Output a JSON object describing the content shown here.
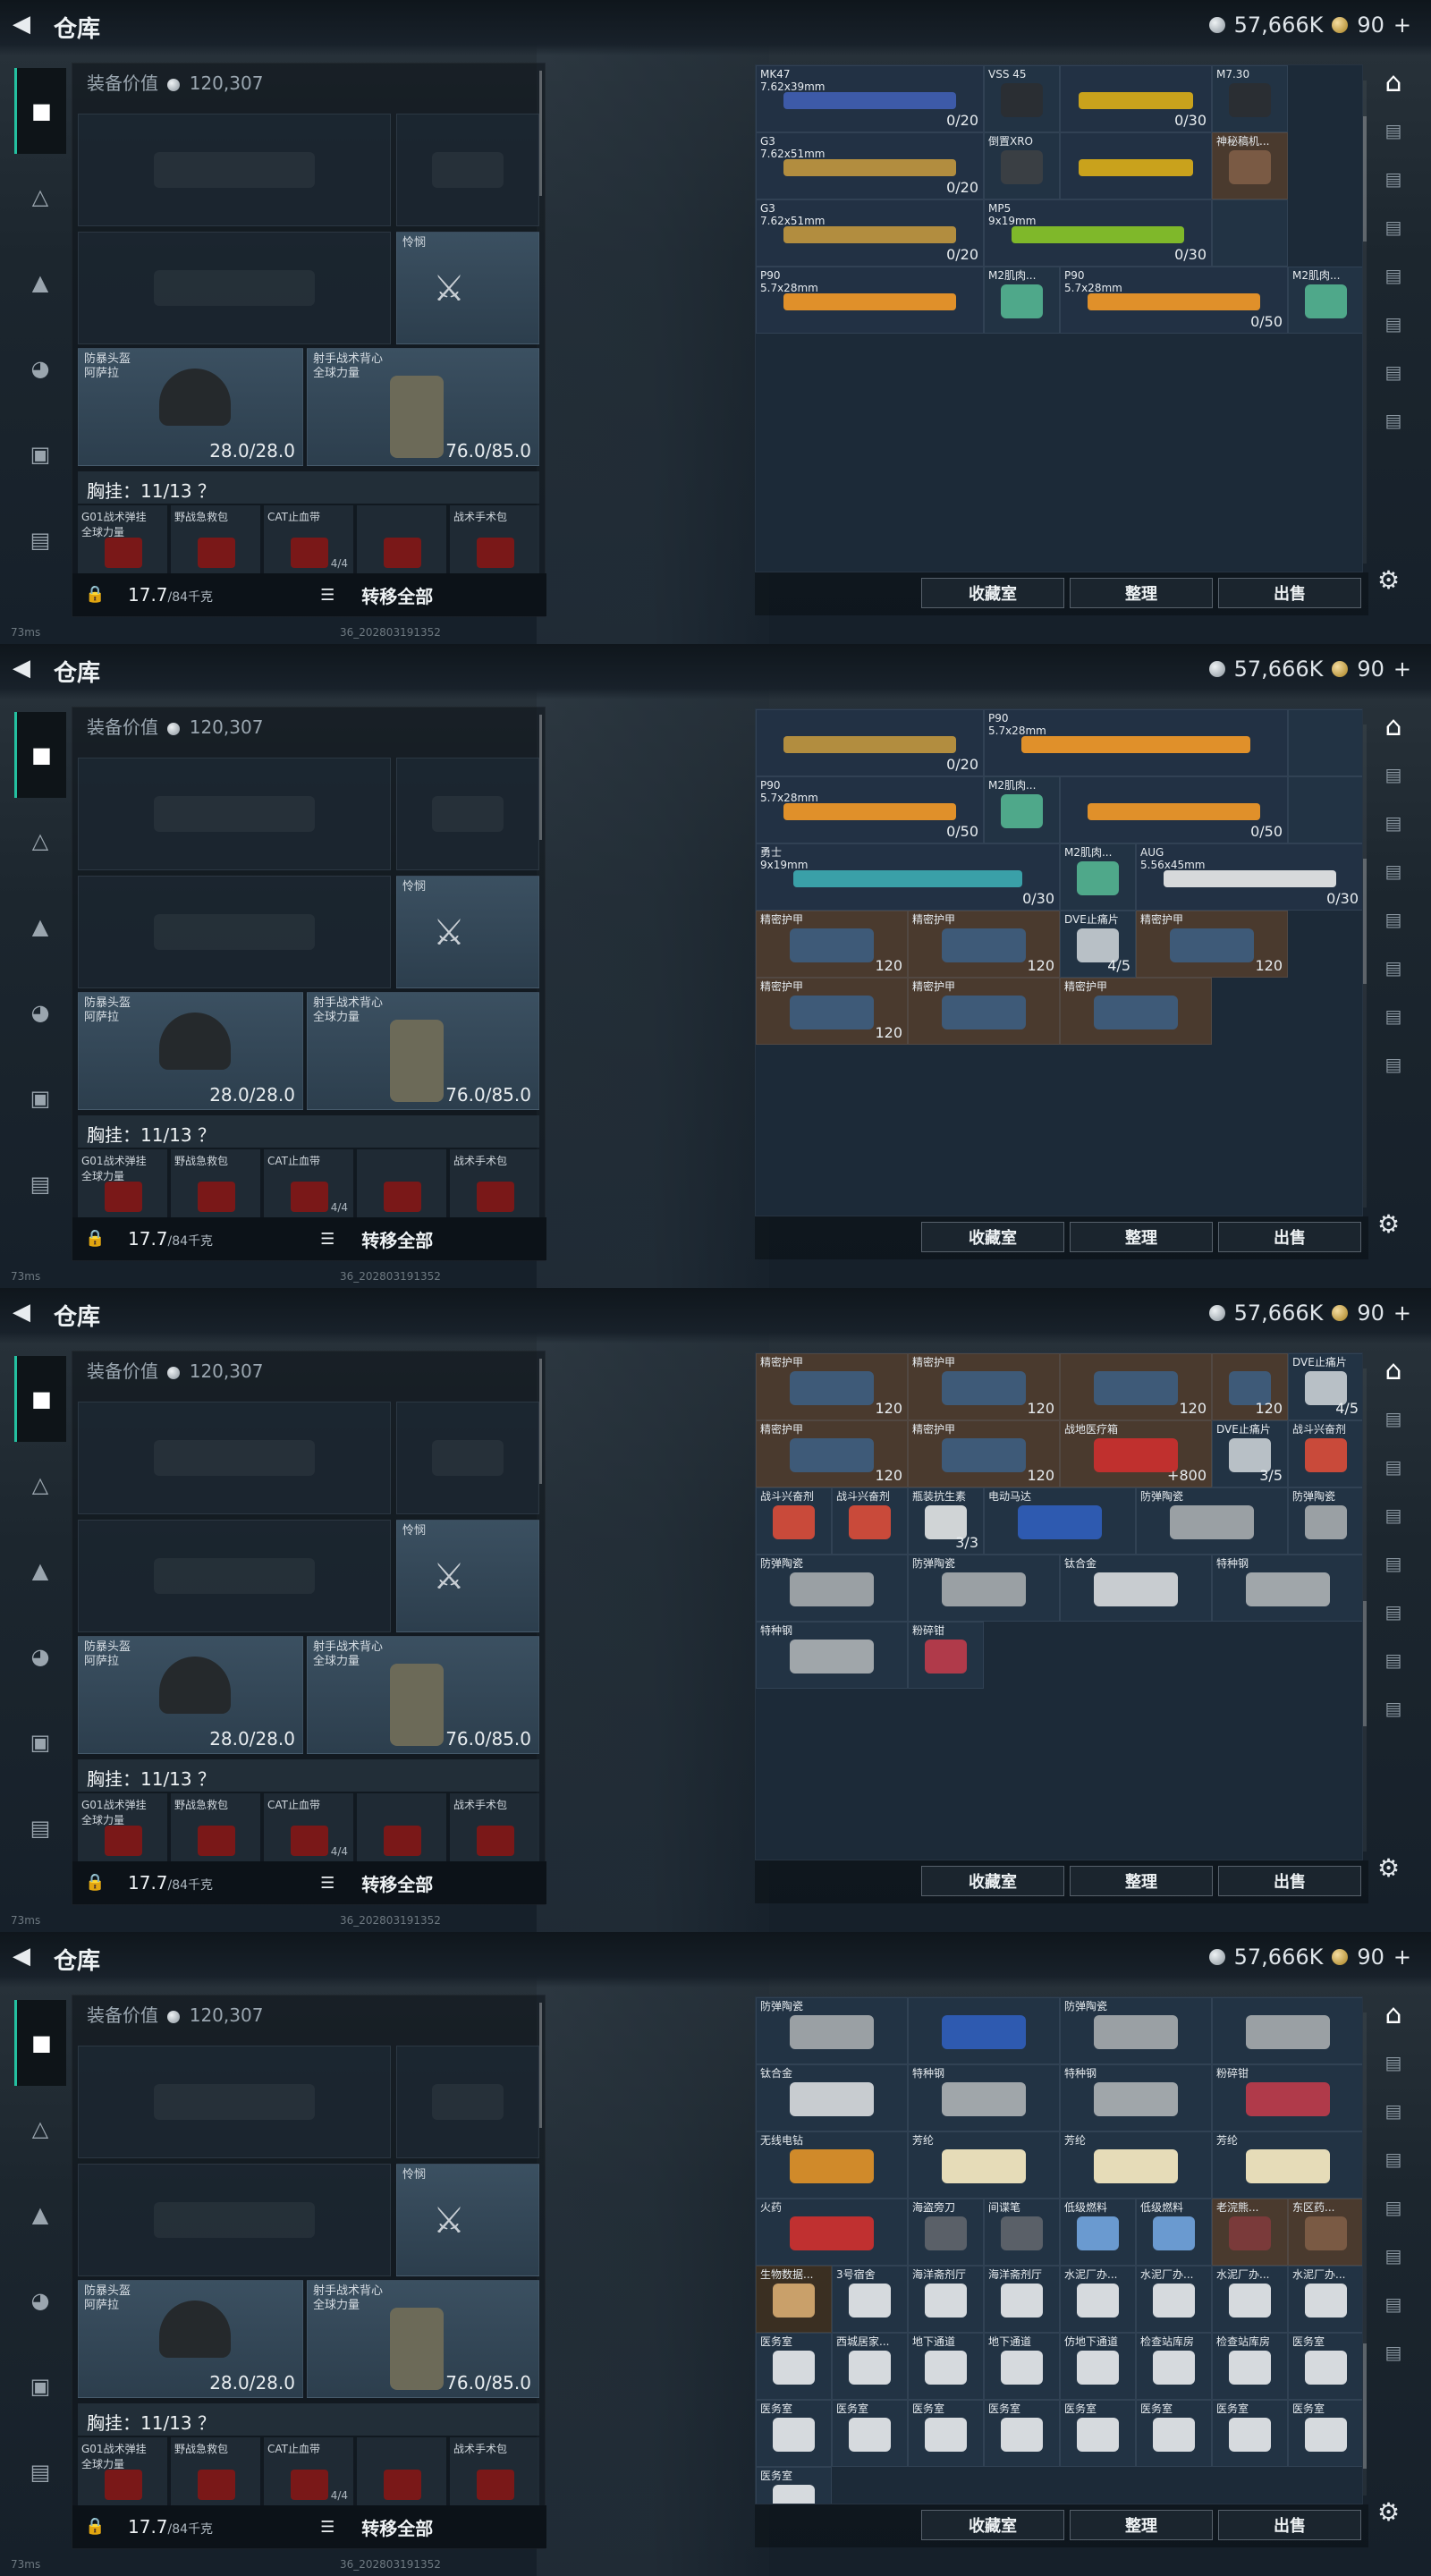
{
  "header": {
    "title": "仓库",
    "silver": "57,666K",
    "gold": "90",
    "plus": "+"
  },
  "left": {
    "equip_value_label": "装备价值",
    "equip_value": "120,307",
    "melee_label": "怜悯",
    "helmet_label": "防暴头盔\n阿萨拉",
    "helmet_val": "28.0/28.0",
    "vest_label": "射手战术背心\n全球力量",
    "vest_val": "76.0/85.0",
    "chest_label": "胸挂：11/13 ？",
    "chest_slots": [
      {
        "name": "G01战术弹挂\n全球力量",
        "count": ""
      },
      {
        "name": "野战急救包",
        "count": ""
      },
      {
        "name": "CAT止血带",
        "count": "4/4"
      },
      {
        "name": "",
        "count": ""
      },
      {
        "name": "战术手术包",
        "count": ""
      }
    ],
    "weight": "17.7",
    "weight_unit": "/84千克",
    "transfer_all": "转移全部",
    "ping": "73ms",
    "build": "36_202803191352"
  },
  "buttons": {
    "collection": "收藏室",
    "sort": "整理",
    "sell": "出售"
  },
  "screens": [
    {
      "cells": [
        {
          "name": "MK47\n7.62x39mm",
          "val": "0/20",
          "span": 3,
          "type": "weap",
          "color": "#3d5aa8"
        },
        {
          "name": "VSS 45",
          "val": "",
          "span": 1,
          "type": "cell",
          "color": "#2a2e33"
        },
        {
          "name": "",
          "val": "0/30",
          "span": 2,
          "type": "weap",
          "color": "#c9a21c"
        },
        {
          "name": "M7.30",
          "val": "",
          "span": 1,
          "type": "cell",
          "color": "#2a2e33"
        },
        {
          "name": "G3\n7.62x51mm",
          "val": "0/20",
          "span": 3,
          "type": "weap",
          "color": "#b28d3f"
        },
        {
          "name": "倒置XRO",
          "val": "",
          "span": 1,
          "type": "cell",
          "color": "#3a3f44"
        },
        {
          "name": "",
          "val": "",
          "span": 2,
          "type": "weap",
          "color": "#c9a21c"
        },
        {
          "name": "神秘稿机...",
          "val": "",
          "span": 1,
          "type": "brown",
          "color": "#7a5a44"
        },
        {
          "name": "G3\n7.62x51mm",
          "val": "0/20",
          "span": 3,
          "type": "weap",
          "color": "#b28d3f"
        },
        {
          "name": "MP5\n9x19mm",
          "val": "0/30",
          "span": 3,
          "type": "weap",
          "color": "#7fb82a"
        },
        {
          "name": "",
          "val": "",
          "span": 1,
          "type": "cell",
          "color": ""
        },
        {
          "name": "P90\n5.7x28mm",
          "val": "",
          "span": 3,
          "type": "weap",
          "color": "#e0902a"
        },
        {
          "name": "M2肌肉...",
          "val": "",
          "span": 1,
          "type": "cell",
          "color": "#4fa88a"
        },
        {
          "name": "P90\n5.7x28mm",
          "val": "0/50",
          "span": 3,
          "type": "weap",
          "color": "#e0902a"
        },
        {
          "name": "M2肌肉...",
          "val": "",
          "span": 1,
          "type": "cell",
          "color": "#4fa88a"
        }
      ]
    },
    {
      "cells": [
        {
          "name": "",
          "val": "0/20",
          "span": 3,
          "type": "weap",
          "color": "#b28d3f"
        },
        {
          "name": "P90\n5.7x28mm",
          "val": "",
          "span": 4,
          "type": "weap",
          "color": "#e0902a"
        },
        {
          "name": "",
          "val": "",
          "span": 1,
          "type": "cell",
          "color": ""
        },
        {
          "name": "P90\n5.7x28mm",
          "val": "0/50",
          "span": 3,
          "type": "weap",
          "color": "#e0902a"
        },
        {
          "name": "M2肌肉...",
          "val": "",
          "span": 1,
          "type": "cell",
          "color": "#4fa88a"
        },
        {
          "name": "",
          "val": "0/50",
          "span": 3,
          "type": "weap",
          "color": "#e0902a"
        },
        {
          "name": "",
          "val": "",
          "span": 1,
          "type": "cell",
          "color": ""
        },
        {
          "name": "勇士\n9x19mm",
          "val": "0/30",
          "span": 4,
          "type": "weap",
          "color": "#3aa0a8"
        },
        {
          "name": "M2肌肉...",
          "val": "",
          "span": 1,
          "type": "cell",
          "color": "#4fa88a"
        },
        {
          "name": "AUG\n5.56x45mm",
          "val": "0/30",
          "span": 3,
          "type": "weap",
          "color": "#d7d9db"
        },
        {
          "name": "精密护甲",
          "val": "120",
          "span": 2,
          "type": "brown",
          "color": "#3e5a78"
        },
        {
          "name": "精密护甲",
          "val": "120",
          "span": 2,
          "type": "brown",
          "color": "#3e5a78"
        },
        {
          "name": "DVE止痛片",
          "val": "4/5",
          "span": 1,
          "type": "cell",
          "color": "#b8c0c6"
        },
        {
          "name": "精密护甲",
          "val": "120",
          "span": 2,
          "type": "brown",
          "color": "#3e5a78"
        },
        {
          "name": "精密护甲",
          "val": "120",
          "span": 2,
          "type": "brown",
          "color": "#3e5a78"
        },
        {
          "name": "精密护甲",
          "val": "",
          "span": 2,
          "type": "brown",
          "color": "#3e5a78"
        },
        {
          "name": "精密护甲",
          "val": "",
          "span": 2,
          "type": "brown",
          "color": "#3e5a78"
        }
      ]
    },
    {
      "cells": [
        {
          "name": "精密护甲",
          "val": "120",
          "span": 2,
          "type": "brown",
          "color": "#3e5a78"
        },
        {
          "name": "精密护甲",
          "val": "120",
          "span": 2,
          "type": "brown",
          "color": "#3e5a78"
        },
        {
          "name": "",
          "val": "120",
          "span": 2,
          "type": "brown",
          "color": "#3e5a78"
        },
        {
          "name": "",
          "val": "120",
          "span": 1,
          "type": "brown",
          "color": "#3e5a78"
        },
        {
          "name": "DVE止痛片",
          "val": "4/5",
          "span": 1,
          "type": "cell",
          "color": "#b8c0c6"
        },
        {
          "name": "精密护甲",
          "val": "120",
          "span": 2,
          "type": "brown",
          "color": "#3e5a78"
        },
        {
          "name": "精密护甲",
          "val": "120",
          "span": 2,
          "type": "brown",
          "color": "#3e5a78"
        },
        {
          "name": "战地医疗箱",
          "val": "+800",
          "span": 2,
          "type": "brown",
          "color": "#c0302e"
        },
        {
          "name": "DVE止痛片",
          "val": "3/5",
          "span": 1,
          "type": "cell",
          "color": "#b8c0c6"
        },
        {
          "name": "战斗兴奋剂",
          "val": "",
          "span": 1,
          "type": "cell",
          "color": "#c94a3a"
        },
        {
          "name": "战斗兴奋剂",
          "val": "",
          "span": 1,
          "type": "cell",
          "color": "#c94a3a"
        },
        {
          "name": "战斗兴奋剂",
          "val": "",
          "span": 1,
          "type": "cell",
          "color": "#c94a3a"
        },
        {
          "name": "瓶装抗生素",
          "val": "3/3",
          "span": 1,
          "type": "cell",
          "color": "#d0d4d6"
        },
        {
          "name": "电动马达",
          "val": "",
          "span": 2,
          "type": "cell",
          "color": "#2e5ab0"
        },
        {
          "name": "防弹陶瓷",
          "val": "",
          "span": 2,
          "type": "cell",
          "color": "#9aa0a4"
        },
        {
          "name": "防弹陶瓷",
          "val": "",
          "span": 1,
          "type": "cell",
          "color": "#9aa0a4"
        },
        {
          "name": "防弹陶瓷",
          "val": "",
          "span": 2,
          "type": "cell",
          "color": "#9aa0a4"
        },
        {
          "name": "防弹陶瓷",
          "val": "",
          "span": 2,
          "type": "cell",
          "color": "#9aa0a4"
        },
        {
          "name": "钛合金",
          "val": "",
          "span": 2,
          "type": "cell",
          "color": "#c8ccd0"
        },
        {
          "name": "特种钢",
          "val": "",
          "span": 2,
          "type": "cell",
          "color": "#a0a6aa"
        },
        {
          "name": "特种钢",
          "val": "",
          "span": 2,
          "type": "cell",
          "color": "#a0a6aa"
        },
        {
          "name": "粉碎钳",
          "val": "",
          "span": 1,
          "type": "cell",
          "color": "#b03a4a"
        }
      ]
    },
    {
      "cells": [
        {
          "name": "防弹陶瓷",
          "val": "",
          "span": 2,
          "type": "cell",
          "color": "#9aa0a4"
        },
        {
          "name": "",
          "val": "",
          "span": 2,
          "type": "cell",
          "color": "#2e5ab0"
        },
        {
          "name": "防弹陶瓷",
          "val": "",
          "span": 2,
          "type": "cell",
          "color": "#9aa0a4"
        },
        {
          "name": "",
          "val": "",
          "span": 2,
          "type": "cell",
          "color": "#9aa0a4"
        },
        {
          "name": "钛合金",
          "val": "",
          "span": 2,
          "type": "cell",
          "color": "#c8ccd0"
        },
        {
          "name": "特种钢",
          "val": "",
          "span": 2,
          "type": "cell",
          "color": "#a0a6aa"
        },
        {
          "name": "特种钢",
          "val": "",
          "span": 2,
          "type": "cell",
          "color": "#a0a6aa"
        },
        {
          "name": "粉碎钳",
          "val": "",
          "span": 2,
          "type": "cell",
          "color": "#b03a4a"
        },
        {
          "name": "无线电钻",
          "val": "",
          "span": 2,
          "type": "cell",
          "color": "#d08a2a"
        },
        {
          "name": "芳纶",
          "val": "",
          "span": 2,
          "type": "cell",
          "color": "#e6dcb8"
        },
        {
          "name": "芳纶",
          "val": "",
          "span": 2,
          "type": "cell",
          "color": "#e6dcb8"
        },
        {
          "name": "芳纶",
          "val": "",
          "span": 2,
          "type": "cell",
          "color": "#e6dcb8"
        },
        {
          "name": "火药",
          "val": "",
          "span": 2,
          "type": "cell",
          "color": "#c03030"
        },
        {
          "name": "海盗旁刀",
          "val": "",
          "span": 1,
          "type": "cell",
          "color": "#5a6068"
        },
        {
          "name": "间谍笔",
          "val": "",
          "span": 1,
          "type": "cell",
          "color": "#5a6068"
        },
        {
          "name": "低级燃料",
          "val": "",
          "span": 1,
          "type": "cell",
          "color": "#6a9ad0"
        },
        {
          "name": "低级燃料",
          "val": "",
          "span": 1,
          "type": "cell",
          "color": "#6a9ad0"
        },
        {
          "name": "老浣熊...",
          "val": "",
          "span": 1,
          "type": "brown",
          "color": "#7a3a3a"
        },
        {
          "name": "东区药...",
          "val": "",
          "span": 1,
          "type": "brown",
          "color": "#7a5a44"
        },
        {
          "name": "生物数据...",
          "val": "",
          "span": 1,
          "type": "gold",
          "color": "#c9a06a"
        },
        {
          "name": "3号宿舍",
          "val": "",
          "span": 1,
          "type": "cell",
          "color": "#d6dade"
        },
        {
          "name": "海洋斋剂厅",
          "val": "",
          "span": 1,
          "type": "cell",
          "color": "#d6dade"
        },
        {
          "name": "海洋斋剂厅",
          "val": "",
          "span": 1,
          "type": "cell",
          "color": "#d6dade"
        },
        {
          "name": "水泥厂办...",
          "val": "",
          "span": 1,
          "type": "cell",
          "color": "#d6dade"
        },
        {
          "name": "水泥厂办...",
          "val": "",
          "span": 1,
          "type": "cell",
          "color": "#d6dade"
        },
        {
          "name": "水泥厂办...",
          "val": "",
          "span": 1,
          "type": "cell",
          "color": "#d6dade"
        },
        {
          "name": "水泥厂办...",
          "val": "",
          "span": 1,
          "type": "cell",
          "color": "#d6dade"
        },
        {
          "name": "医务室",
          "val": "",
          "span": 1,
          "type": "cell",
          "color": "#d6dade"
        },
        {
          "name": "西城居家...",
          "val": "",
          "span": 1,
          "type": "cell",
          "color": "#d6dade"
        },
        {
          "name": "地下通道",
          "val": "",
          "span": 1,
          "type": "cell",
          "color": "#d6dade"
        },
        {
          "name": "地下通道",
          "val": "",
          "span": 1,
          "type": "cell",
          "color": "#d6dade"
        },
        {
          "name": "仿地下通道",
          "val": "",
          "span": 1,
          "type": "cell",
          "color": "#d6dade"
        },
        {
          "name": "检查站库房",
          "val": "",
          "span": 1,
          "type": "cell",
          "color": "#d6dade"
        },
        {
          "name": "检查站库房",
          "val": "",
          "span": 1,
          "type": "cell",
          "color": "#d6dade"
        },
        {
          "name": "医务室",
          "val": "",
          "span": 1,
          "type": "cell",
          "color": "#d6dade"
        },
        {
          "name": "医务室",
          "val": "",
          "span": 1,
          "type": "cell",
          "color": "#d6dade"
        },
        {
          "name": "医务室",
          "val": "",
          "span": 1,
          "type": "cell",
          "color": "#d6dade"
        },
        {
          "name": "医务室",
          "val": "",
          "span": 1,
          "type": "cell",
          "color": "#d6dade"
        },
        {
          "name": "医务室",
          "val": "",
          "span": 1,
          "type": "cell",
          "color": "#d6dade"
        },
        {
          "name": "医务室",
          "val": "",
          "span": 1,
          "type": "cell",
          "color": "#d6dade"
        },
        {
          "name": "医务室",
          "val": "",
          "span": 1,
          "type": "cell",
          "color": "#d6dade"
        },
        {
          "name": "医务室",
          "val": "",
          "span": 1,
          "type": "cell",
          "color": "#d6dade"
        },
        {
          "name": "医务室",
          "val": "",
          "span": 1,
          "type": "cell",
          "color": "#d6dade"
        },
        {
          "name": "医务室",
          "val": "",
          "span": 1,
          "type": "cell",
          "color": "#d6dade"
        }
      ]
    }
  ],
  "icons": {
    "back": "back-arrow-icon",
    "tabs": [
      "pistol-icon",
      "backpack-icon",
      "armor-icon",
      "helmet-icon",
      "clipboard-icon",
      "briefcase-icon"
    ],
    "side": [
      "gate-icon",
      "vault-1-icon",
      "vault-2-icon",
      "vault-3-icon",
      "vault-4-icon",
      "vault-5-icon",
      "vault-6-icon",
      "vault-7-icon"
    ],
    "settings": "gear-icon"
  }
}
